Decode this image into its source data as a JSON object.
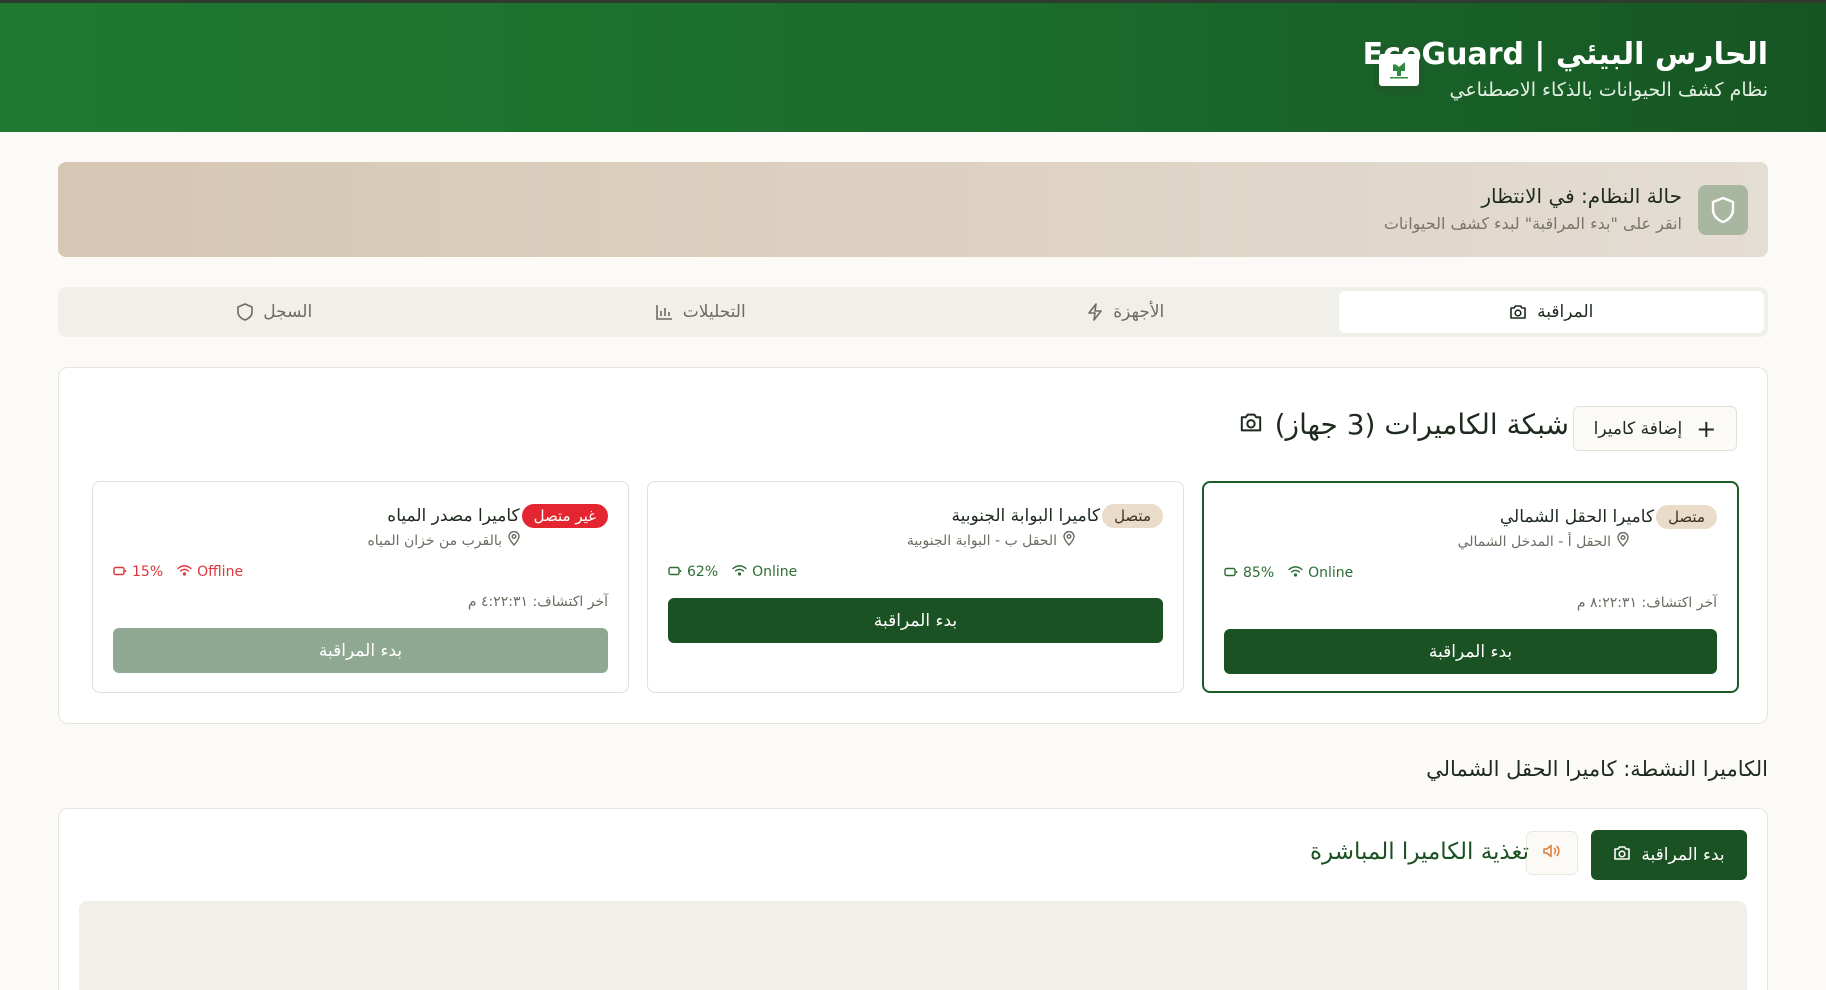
{
  "header": {
    "title": "الحارس البيئي | EcoGuard",
    "subtitle": "نظام كشف الحيوانات بالذكاء الاصطناعي"
  },
  "status": {
    "title": "حالة النظام: في الانتظار",
    "hint": "انقر على \"بدء المراقبة\" لبدء كشف الحيوانات"
  },
  "tabs": [
    {
      "label": "المراقبة",
      "icon": "camera-icon",
      "active": true
    },
    {
      "label": "الأجهزة",
      "icon": "lightning-icon",
      "active": false
    },
    {
      "label": "التحليلات",
      "icon": "bar-chart-icon",
      "active": false
    },
    {
      "label": "السجل",
      "icon": "shield-icon",
      "active": false
    }
  ],
  "network": {
    "title": "شبكة الكاميرات (3 جهاز)",
    "add_label": "إضافة كاميرا",
    "cameras": [
      {
        "name": "كاميرا الحقل الشمالي",
        "status": "متصل",
        "location": "الحقل أ - المدخل الشمالي",
        "connection": "Online",
        "battery": "85%",
        "last_detection": "آخر اكتشاف: ٨:٢٢:٣١ م",
        "button": "بدء المراقبة"
      },
      {
        "name": "كاميرا البوابة الجنوبية",
        "status": "متصل",
        "location": "الحقل ب - البوابة الجنوبية",
        "connection": "Online",
        "battery": "62%",
        "last_detection": "",
        "button": "بدء المراقبة"
      },
      {
        "name": "كاميرا مصدر المياه",
        "status": "غير متصل",
        "location": "بالقرب من خزان المياه",
        "connection": "Offline",
        "battery": "15%",
        "last_detection": "آخر اكتشاف: ٤:٢٢:٣١ م",
        "button": "بدء المراقبة"
      }
    ]
  },
  "active": {
    "label": "الكاميرا النشطة: كاميرا الحقل الشمالي"
  },
  "feed": {
    "title": "تغذية الكاميرا المباشرة",
    "start_label": "بدء المراقبة"
  },
  "colors": {
    "header_green": "#1f7a31",
    "primary_button": "#1b5223",
    "disabled_button": "#8ea892",
    "offline_red": "#e3262f",
    "online_green": "#2c6e35"
  }
}
